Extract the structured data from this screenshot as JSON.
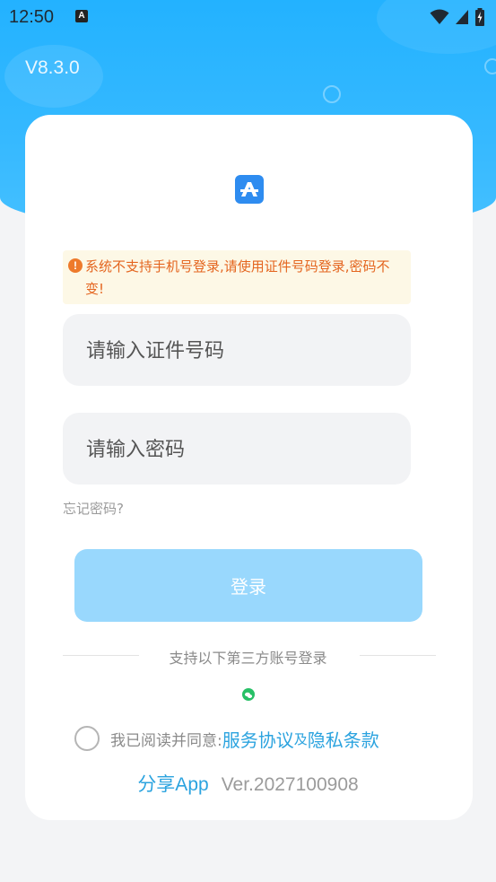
{
  "status_bar": {
    "time": "12:50",
    "notif_letter": "A"
  },
  "header": {
    "version": "V8.3.0"
  },
  "colors": {
    "brand_blue": "#23b2ff",
    "button_disabled": "#99d8fd",
    "warning_text": "#e4651f",
    "link": "#2ba3df"
  },
  "icons": {
    "logo": "app-logo-icon",
    "warning": "exclamation-circle-icon",
    "wechat": "wechat-icon"
  },
  "login": {
    "warning": "系统不支持手机号登录,请使用证件号码登录,密码不变!",
    "id_placeholder": "请输入证件号码",
    "password_placeholder": "请输入密码",
    "forgot_password": "忘记密码?",
    "login_button": "登录",
    "third_party_label": "支持以下第三方账号登录",
    "agree_prefix": "我已阅读并同意:",
    "service_agreement": "服务协议",
    "and": "及",
    "privacy_policy": "隐私条款",
    "share_app": "分享App",
    "build_version": "Ver.2027100908"
  }
}
